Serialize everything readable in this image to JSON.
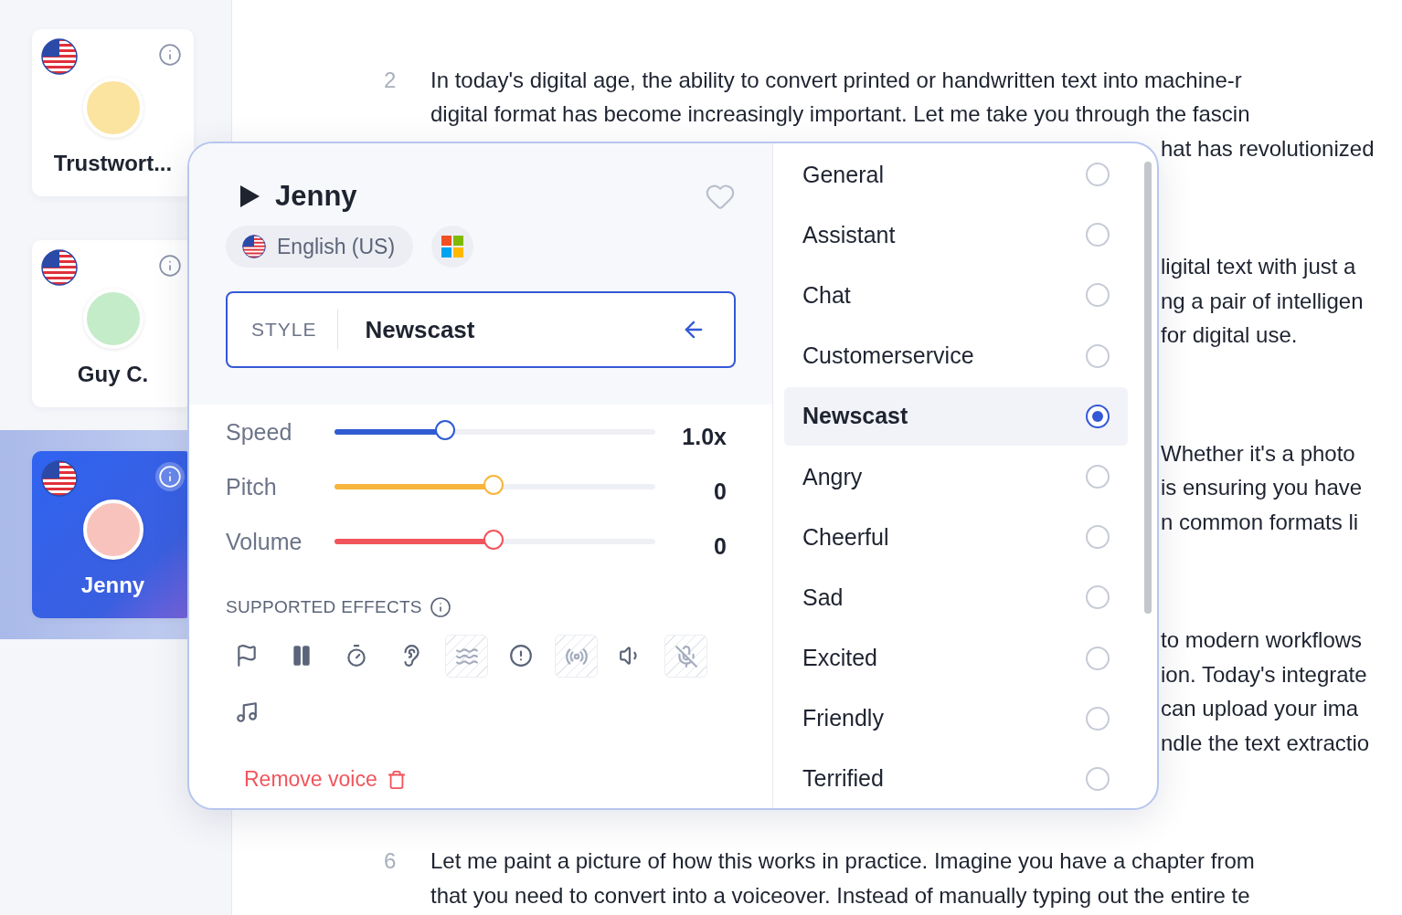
{
  "voices": [
    {
      "name": "Trustwort...",
      "selected": false,
      "color": "#fbe3a0"
    },
    {
      "name": "Guy C.",
      "selected": false,
      "color": "#c4ecc8"
    },
    {
      "name": "Jenny",
      "selected": true,
      "color": "#f9c3bd"
    }
  ],
  "document": {
    "paragraphs": [
      {
        "number": "2",
        "lines": [
          {
            "kind": "full",
            "text": "In today's digital age, the ability to convert printed or handwritten text into machine-r"
          },
          {
            "kind": "full",
            "text": "digital format has become increasingly important. Let me take you through the fascin"
          },
          {
            "kind": "fragment",
            "text": "hat has revolutionized"
          }
        ]
      },
      {
        "lines": [
          {
            "kind": "fragment",
            "text": "ligital text with just a"
          },
          {
            "kind": "fragment",
            "text": "ng a pair of intelligen"
          },
          {
            "kind": "fragment",
            "text": "for digital use."
          }
        ]
      },
      {
        "lines": [
          {
            "kind": "fragment",
            "text": "Whether it's a photo"
          },
          {
            "kind": "fragment",
            "text": "is ensuring you have"
          },
          {
            "kind": "fragment",
            "text": "n common formats li"
          }
        ]
      },
      {
        "lines": [
          {
            "kind": "fragment",
            "text": "to modern workflows"
          },
          {
            "kind": "fragment",
            "text": "ion. Today's integrate"
          },
          {
            "kind": "fragment",
            "text": "can upload your ima"
          },
          {
            "kind": "fragment",
            "text": "ndle the text extractio"
          }
        ]
      },
      {
        "number": "6",
        "lines": [
          {
            "kind": "full",
            "text": "Let me paint a picture of how this works in practice. Imagine you have a chapter from"
          },
          {
            "kind": "full",
            "text": "that you need to convert into a voiceover. Instead of manually typing out the entire te"
          }
        ]
      }
    ]
  },
  "voice_panel": {
    "name": "Jenny",
    "favorite": false,
    "language": "English (US)",
    "style": {
      "label": "STYLE",
      "value": "Newscast"
    },
    "sliders": [
      {
        "label": "Speed",
        "level": 0.35,
        "reading": "1.0x",
        "color": "#2f5bd3"
      },
      {
        "label": "Pitch",
        "level": 0.5,
        "reading": "0",
        "color": "#f7b53b"
      },
      {
        "label": "Volume",
        "level": 0.5,
        "reading": "0",
        "color": "#f2545b"
      }
    ],
    "effects_title": "SUPPORTED EFFECTS",
    "effects": [
      {
        "kind": "flag",
        "disabled": false
      },
      {
        "kind": "pause",
        "disabled": false
      },
      {
        "kind": "timer",
        "disabled": false
      },
      {
        "kind": "ear",
        "disabled": false
      },
      {
        "kind": "waves",
        "disabled": true
      },
      {
        "kind": "alert",
        "disabled": false
      },
      {
        "kind": "hearing",
        "disabled": true
      },
      {
        "kind": "volume",
        "disabled": false
      },
      {
        "kind": "mic-off",
        "disabled": true
      },
      {
        "kind": "music",
        "disabled": false
      }
    ],
    "remove_label": "Remove voice"
  },
  "styles": [
    {
      "label": "General",
      "selected": false
    },
    {
      "label": "Assistant",
      "selected": false
    },
    {
      "label": "Chat",
      "selected": false
    },
    {
      "label": "Customerservice",
      "selected": false
    },
    {
      "label": "Newscast",
      "selected": true
    },
    {
      "label": "Angry",
      "selected": false
    },
    {
      "label": "Cheerful",
      "selected": false
    },
    {
      "label": "Sad",
      "selected": false
    },
    {
      "label": "Excited",
      "selected": false
    },
    {
      "label": "Friendly",
      "selected": false
    },
    {
      "label": "Terrified",
      "selected": false
    }
  ]
}
